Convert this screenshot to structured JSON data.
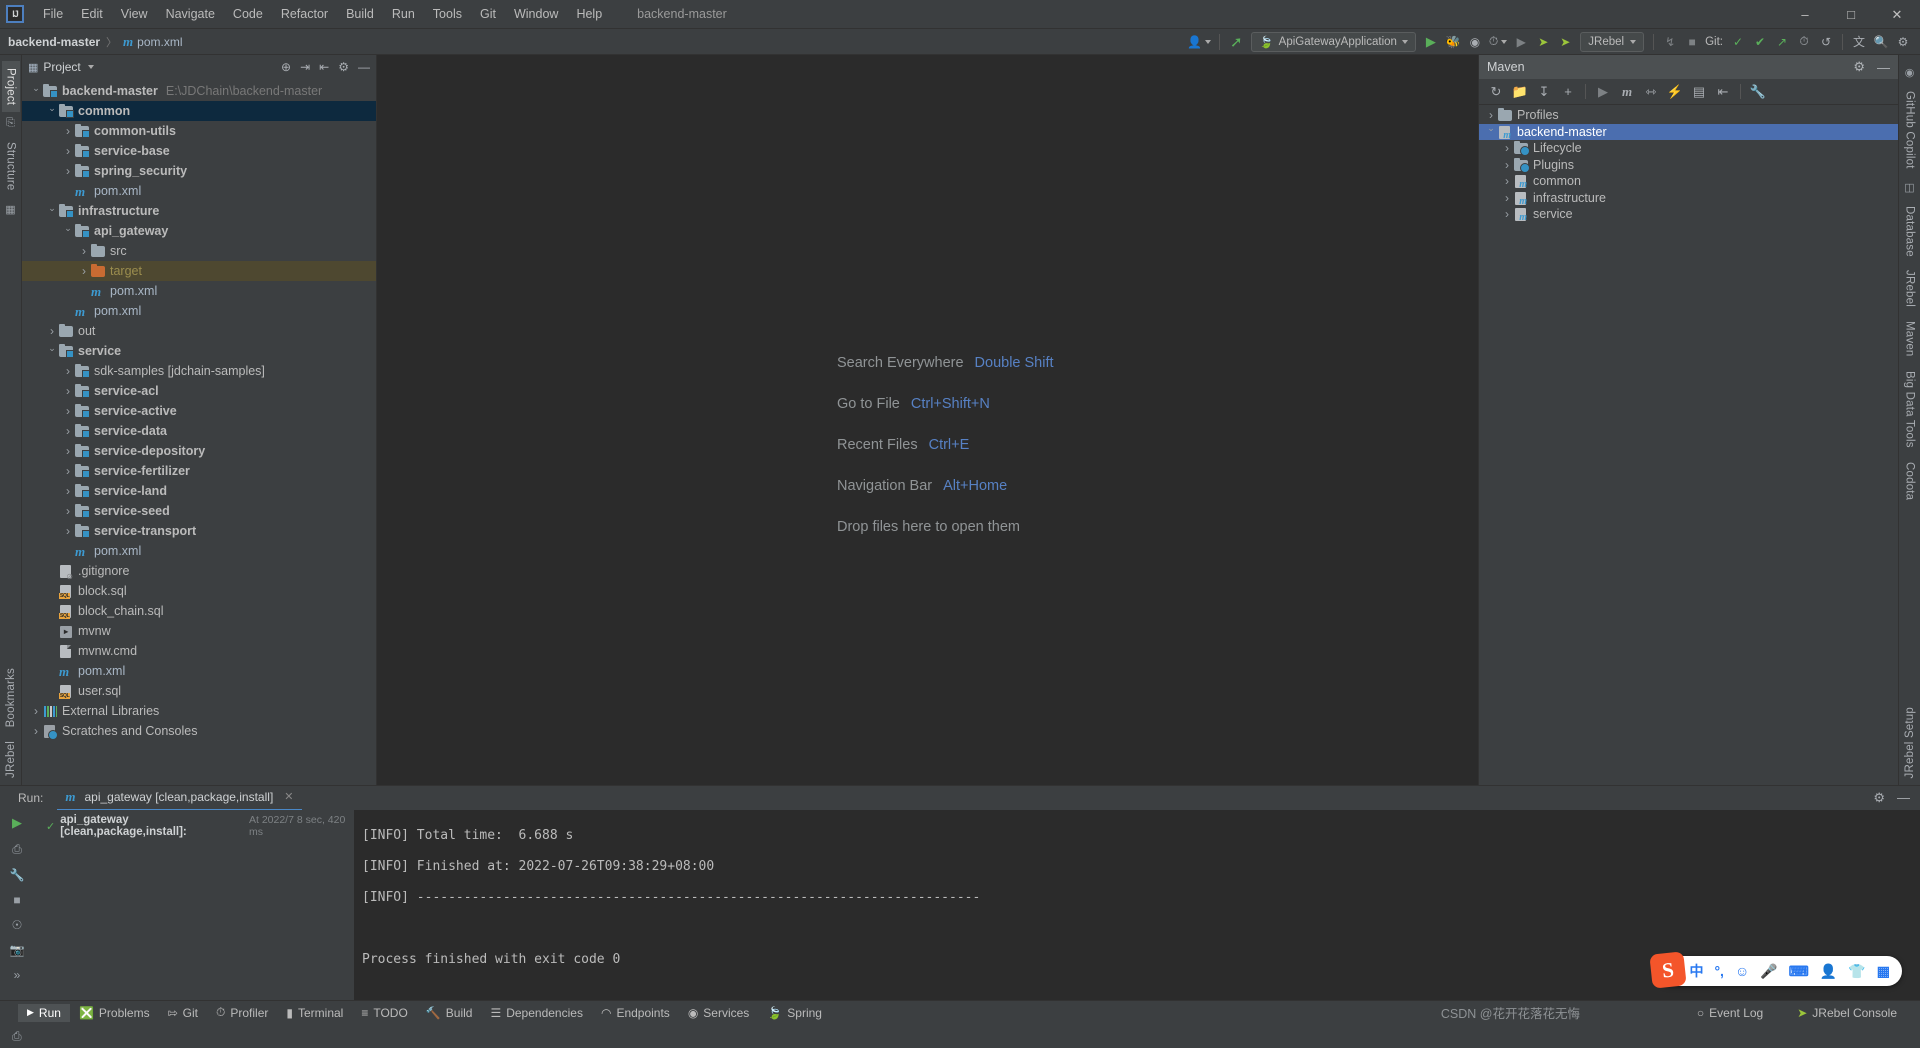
{
  "window": {
    "title": "backend-master",
    "logo": "IJ",
    "controls": [
      "minimize",
      "maximize",
      "close"
    ]
  },
  "menu": [
    {
      "label": "File"
    },
    {
      "label": "Edit"
    },
    {
      "label": "View"
    },
    {
      "label": "Navigate"
    },
    {
      "label": "Code"
    },
    {
      "label": "Refactor"
    },
    {
      "label": "Build"
    },
    {
      "label": "Run"
    },
    {
      "label": "Tools"
    },
    {
      "label": "Git"
    },
    {
      "label": "Window"
    },
    {
      "label": "Help"
    }
  ],
  "navbar": {
    "project": "backend-master",
    "separator": "〉",
    "file": "pom.xml",
    "run_config": "ApiGatewayApplication",
    "jrebel": "JRebel",
    "git_label": "Git:"
  },
  "project_panel": {
    "title": "Project",
    "root": {
      "label": "backend-master",
      "path": "E:\\JDChain\\backend-master"
    },
    "nodes": [
      {
        "depth": 0,
        "arrow": "down",
        "icon": "folder-module",
        "label": "backend-master",
        "bold": true,
        "suffix": "E:\\JDChain\\backend-master"
      },
      {
        "depth": 1,
        "arrow": "down",
        "icon": "folder-module",
        "label": "common",
        "bold": true,
        "state": "selected-blue"
      },
      {
        "depth": 2,
        "arrow": "right",
        "icon": "folder-module",
        "label": "common-utils",
        "bold": true
      },
      {
        "depth": 2,
        "arrow": "right",
        "icon": "folder-module",
        "label": "service-base",
        "bold": true
      },
      {
        "depth": 2,
        "arrow": "right",
        "icon": "folder-module",
        "label": "spring_security",
        "bold": true
      },
      {
        "depth": 2,
        "arrow": "none",
        "icon": "maven-m",
        "label": "pom.xml"
      },
      {
        "depth": 1,
        "arrow": "down",
        "icon": "folder-module",
        "label": "infrastructure",
        "bold": true
      },
      {
        "depth": 2,
        "arrow": "down",
        "icon": "folder-module",
        "label": "api_gateway",
        "bold": true
      },
      {
        "depth": 3,
        "arrow": "right",
        "icon": "folder-plain",
        "label": "src"
      },
      {
        "depth": 3,
        "arrow": "right",
        "icon": "folder-orange",
        "label": "target",
        "state": "selected-olive"
      },
      {
        "depth": 3,
        "arrow": "none",
        "icon": "maven-m",
        "label": "pom.xml"
      },
      {
        "depth": 2,
        "arrow": "none",
        "icon": "maven-m",
        "label": "pom.xml"
      },
      {
        "depth": 1,
        "arrow": "right",
        "icon": "folder-plain",
        "label": "out"
      },
      {
        "depth": 1,
        "arrow": "down",
        "icon": "folder-module",
        "label": "service",
        "bold": true
      },
      {
        "depth": 2,
        "arrow": "right",
        "icon": "folder-module",
        "label": "sdk-samples [jdchain-samples]"
      },
      {
        "depth": 2,
        "arrow": "right",
        "icon": "folder-module",
        "label": "service-acl",
        "bold": true
      },
      {
        "depth": 2,
        "arrow": "right",
        "icon": "folder-module",
        "label": "service-active",
        "bold": true
      },
      {
        "depth": 2,
        "arrow": "right",
        "icon": "folder-module",
        "label": "service-data",
        "bold": true
      },
      {
        "depth": 2,
        "arrow": "right",
        "icon": "folder-module",
        "label": "service-depository",
        "bold": true
      },
      {
        "depth": 2,
        "arrow": "right",
        "icon": "folder-module",
        "label": "service-fertilizer",
        "bold": true
      },
      {
        "depth": 2,
        "arrow": "right",
        "icon": "folder-module",
        "label": "service-land",
        "bold": true
      },
      {
        "depth": 2,
        "arrow": "right",
        "icon": "folder-module",
        "label": "service-seed",
        "bold": true
      },
      {
        "depth": 2,
        "arrow": "right",
        "icon": "folder-module",
        "label": "service-transport",
        "bold": true
      },
      {
        "depth": 2,
        "arrow": "none",
        "icon": "maven-m",
        "label": "pom.xml"
      },
      {
        "depth": 1,
        "arrow": "none",
        "icon": "gitignore-file",
        "label": ".gitignore"
      },
      {
        "depth": 1,
        "arrow": "none",
        "icon": "sql-file",
        "label": "block.sql"
      },
      {
        "depth": 1,
        "arrow": "none",
        "icon": "sql-file",
        "label": "block_chain.sql"
      },
      {
        "depth": 1,
        "arrow": "none",
        "icon": "shell-file",
        "label": "mvnw"
      },
      {
        "depth": 1,
        "arrow": "none",
        "icon": "text-file",
        "label": "mvnw.cmd"
      },
      {
        "depth": 1,
        "arrow": "none",
        "icon": "maven-m",
        "label": "pom.xml"
      },
      {
        "depth": 1,
        "arrow": "none",
        "icon": "sql-file",
        "label": "user.sql"
      },
      {
        "depth": 0,
        "arrow": "right",
        "icon": "library",
        "label": "External Libraries"
      },
      {
        "depth": 0,
        "arrow": "right",
        "icon": "scratch",
        "label": "Scratches and Consoles"
      }
    ]
  },
  "editor": {
    "shortcuts": [
      {
        "label": "Search Everywhere",
        "key": "Double Shift"
      },
      {
        "label": "Go to File",
        "key": "Ctrl+Shift+N"
      },
      {
        "label": "Recent Files",
        "key": "Ctrl+E"
      },
      {
        "label": "Navigation Bar",
        "key": "Alt+Home"
      }
    ],
    "drop_hint": "Drop files here to open them"
  },
  "maven_panel": {
    "title": "Maven",
    "nodes": [
      {
        "depth": 0,
        "arrow": "right",
        "icon": "profiles",
        "label": "Profiles"
      },
      {
        "depth": 0,
        "arrow": "down",
        "icon": "maven-project",
        "label": "backend-master",
        "state": "selected"
      },
      {
        "depth": 1,
        "arrow": "right",
        "icon": "folder-cog",
        "label": "Lifecycle"
      },
      {
        "depth": 1,
        "arrow": "right",
        "icon": "folder-cog",
        "label": "Plugins"
      },
      {
        "depth": 1,
        "arrow": "right",
        "icon": "maven-project",
        "label": "common"
      },
      {
        "depth": 1,
        "arrow": "right",
        "icon": "maven-project",
        "label": "infrastructure"
      },
      {
        "depth": 1,
        "arrow": "right",
        "icon": "maven-project",
        "label": "service"
      }
    ]
  },
  "run_panel": {
    "run_label": "Run:",
    "tab_title": "api_gateway [clean,package,install]",
    "tree_item": {
      "name": "api_gateway [clean,package,install]:",
      "meta": "At 2022/7 8 sec, 420 ms"
    },
    "console_lines": [
      "[INFO] Total time:  6.688 s",
      "[INFO] Finished at: 2022-07-26T09:38:29+08:00",
      "[INFO] ------------------------------------------------------------------------",
      "",
      "Process finished with exit code 0"
    ]
  },
  "statusbar": {
    "items": [
      {
        "label": "Run",
        "icon": "play-icon",
        "active": true
      },
      {
        "label": "Problems",
        "icon": "error-icon"
      },
      {
        "label": "Git",
        "icon": "branch-icon"
      },
      {
        "label": "Profiler",
        "icon": "gauge-icon"
      },
      {
        "label": "Terminal",
        "icon": "terminal-icon"
      },
      {
        "label": "TODO",
        "icon": "list-icon"
      },
      {
        "label": "Build",
        "icon": "hammer-icon"
      },
      {
        "label": "Dependencies",
        "icon": "layers-icon"
      },
      {
        "label": "Endpoints",
        "icon": "endpoint-icon"
      },
      {
        "label": "Services",
        "icon": "services-icon"
      },
      {
        "label": "Spring",
        "icon": "leaf-icon"
      }
    ],
    "right": [
      {
        "label": "Event Log",
        "icon": "bell-icon"
      },
      {
        "label": "JRebel Console",
        "icon": "jrebel-icon"
      }
    ],
    "watermark": "CSDN @花开花落花无悔"
  },
  "left_strip": {
    "tabs": [
      {
        "label": "Project",
        "active": true
      },
      {
        "label": "Structure"
      }
    ],
    "bottom_tabs": [
      {
        "label": "Bookmarks"
      },
      {
        "label": "JRebel"
      }
    ]
  },
  "right_strip": {
    "tabs": [
      {
        "label": "GitHub Copilot"
      },
      {
        "label": "Database"
      },
      {
        "label": "JRebel"
      },
      {
        "label": "Maven"
      },
      {
        "label": "Big Data Tools"
      },
      {
        "label": "Codota"
      }
    ],
    "bottom_tabs": [
      {
        "label": "JRebel Setup"
      }
    ]
  },
  "ime_bar": {
    "logo": "S",
    "icons": [
      "chinese-mode-icon",
      "punctuation-icon",
      "emoji-icon",
      "microphone-icon",
      "keyboard-icon",
      "user-icon",
      "skin-icon",
      "apps-icon"
    ]
  },
  "colors": {
    "accent_blue": "#4b6eaf",
    "panel_bg": "#3c3f41",
    "editor_bg": "#2b2b2b",
    "selection_blue": "#0d293e",
    "selection_olive": "#4e4830",
    "link_blue": "#5781c4",
    "green": "#5aaf5a"
  }
}
